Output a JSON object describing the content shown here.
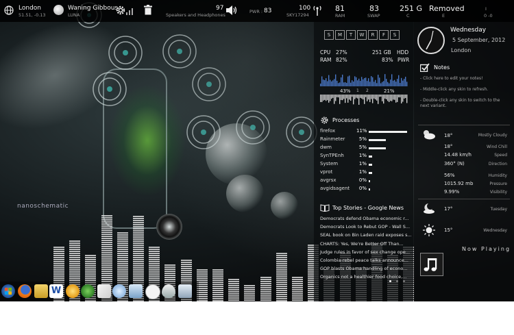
{
  "topbar": {
    "location_city": "London",
    "location_coords": "51.51, -0.13",
    "moon_phase": "Waning Gibbous",
    "moon_label": "LUNA",
    "volume_value": "97",
    "volume_device": "Speakers and Headphones",
    "pwr_label": "PWR :",
    "pwr_value": "83",
    "wifi_value": "100",
    "wifi_ssid": "SKY17294",
    "ram_value": "81",
    "ram_label": "RAM",
    "swap_value": "83",
    "swap_label": "SWAP",
    "disk_value": "251 G",
    "disk_label": "C",
    "removed_label": "Removed",
    "removed_drive": "E",
    "io_top": "I",
    "io_bottom": "0 -0"
  },
  "calendar": {
    "days": [
      "S",
      "M",
      "T",
      "W",
      "R",
      "F",
      "S"
    ]
  },
  "system_stats": {
    "cpu_label": "CPU",
    "cpu_value": "27%",
    "ram_label": "RAM",
    "ram_value": "82%",
    "hdd_value": "251 GB",
    "hdd_label": "HDD",
    "pwr_value": "83%",
    "pwr_label": "PWR",
    "graph_left": "43%",
    "graph_mid_1": "1",
    "graph_mid_2": "2",
    "graph_right": "21%"
  },
  "processes": {
    "title": "Processes",
    "items": [
      {
        "name": "firefox",
        "pct": "11%",
        "level": 1.0
      },
      {
        "name": "Rainmeter",
        "pct": "5%",
        "level": 0.45
      },
      {
        "name": "dwm",
        "pct": "5%",
        "level": 0.45
      },
      {
        "name": "SynTPEnh",
        "pct": "1%",
        "level": 0.09
      },
      {
        "name": "System",
        "pct": "1%",
        "level": 0.09
      },
      {
        "name": "vprot",
        "pct": "1%",
        "level": 0.09
      },
      {
        "name": "avgrsx",
        "pct": "0%",
        "level": 0.0
      },
      {
        "name": "avgidsagent",
        "pct": "0%",
        "level": 0.0
      }
    ]
  },
  "news": {
    "title": "Top Stories - Google News",
    "items": [
      "Democrats defend Obama economic r...",
      "Democrats Look to Rebut GOP - Wall S...",
      "SEAL book on Bin Laden raid exposes s...",
      "CHARTS: Yes, We're Better Off Than...",
      "Judge rules in favor of sex change ope...",
      "Colombia-rebel peace talks announce...",
      "GOP blasts Obama handling of econo...",
      "Organics not a healthier food choice,..."
    ]
  },
  "clock": {
    "weekday": "Wednesday",
    "date": "5 September, 2012",
    "city": "London"
  },
  "notes": {
    "title": "Notes",
    "lines": [
      "- Click here to edit your notes!",
      "- Middle-click any skin to refresh.",
      "- Double-click any skin to switch to the",
      "next variant."
    ]
  },
  "weather": {
    "current_temp": "18°",
    "condition": "Mostly Cloudy",
    "wind_chill_value": "18°",
    "wind_chill_label": "Wind Chill",
    "speed_value": "14.48 km/h",
    "speed_label": "Speed",
    "direction_value": "360° (N)",
    "direction_label": "Direction",
    "humidity_value": "56%",
    "humidity_label": "Humidity",
    "pressure_value": "1015.92 mb",
    "pressure_label": "Pressure",
    "visibility_value": "9.99%",
    "visibility_label": "Visibility",
    "forecast_1_temp": "17°",
    "forecast_1_day": "Tuesday",
    "forecast_2_temp": "15°",
    "forecast_2_day": "Wednesday"
  },
  "now_playing": {
    "title": "Now Playing"
  },
  "wallpaper": {
    "logo_text": "nanoschematic"
  },
  "visualizer": {
    "levels": [
      0.53,
      0.59,
      0.45,
      0.84,
      0.67,
      0.83,
      0.53,
      0.36,
      0.41,
      0.31,
      0.31,
      0.22,
      0.16,
      0.24,
      0.47,
      0.24,
      0.55,
      0.31,
      0.47,
      0.33,
      0.57,
      0.45,
      0.53
    ]
  },
  "colors": {
    "accent_blue": "#4a78c8",
    "panel_bg": "#0a0c0e"
  }
}
